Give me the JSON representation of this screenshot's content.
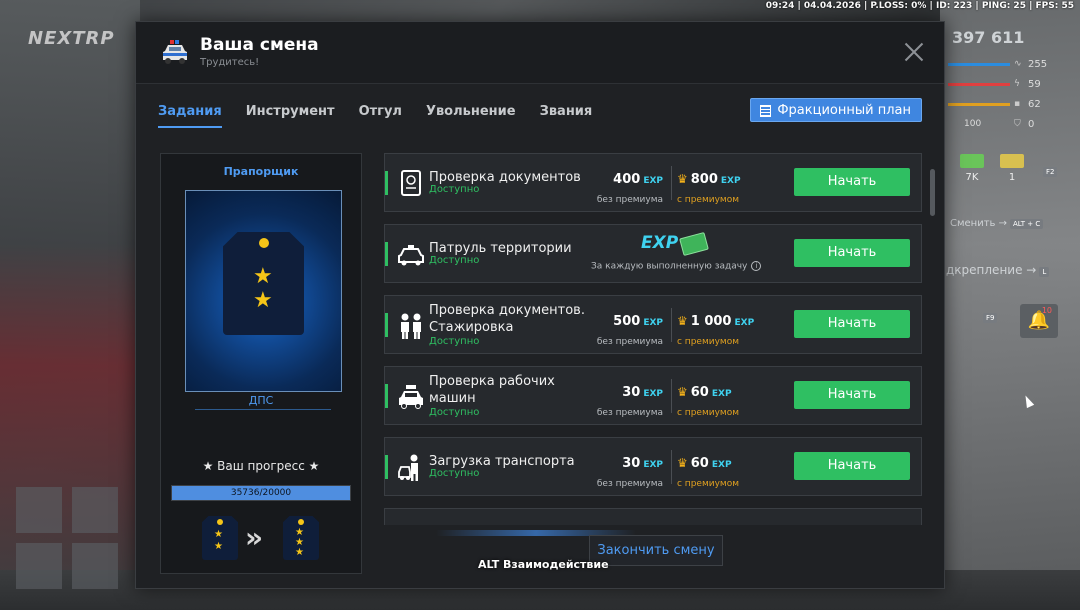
{
  "topbar": {
    "status": "09:24 | 04.04.2026 | P.LOSS: 0% | ID: 223 | PING: 25 | FPS: 55"
  },
  "hud": {
    "logo": "NEXTRP",
    "money": "397 611",
    "stats": [
      {
        "value": "255",
        "color": "#2b8de0"
      },
      {
        "value": "59",
        "color": "#e04040"
      },
      {
        "value": "62",
        "color": "#e0a020"
      },
      {
        "value": "0",
        "color": "#888888"
      }
    ],
    "stat_extra": "100",
    "cash": [
      {
        "label": "7K",
        "color": "#6ac45a"
      },
      {
        "label": "1",
        "color": "#d8c050"
      }
    ],
    "key_f2": "F2",
    "change_text": "Сменить →",
    "change_keys": "ALT + C",
    "reinforce_text": "дкрепление →",
    "reinforce_key": "L",
    "key_f9": "F9",
    "bell_count": "10"
  },
  "panel": {
    "title": "Ваша смена",
    "subtitle": "Трудитесь!",
    "tabs": [
      "Задания",
      "Инструмент",
      "Отгул",
      "Увольнение",
      "Звания"
    ],
    "plan_button": "Фракционный план",
    "rank": {
      "name": "Прапорщик",
      "department": "ДПС",
      "progress_label": "★ Ваш прогресс ★",
      "progress_text": "35736/20000",
      "progress_fraction": 1.0
    },
    "exp_label": "EXP",
    "no_premium": "без премиума",
    "with_premium": "с премиумом",
    "start_label": "Начать",
    "tasks": [
      {
        "name": "Проверка документов",
        "status": "Доступно",
        "base": "400",
        "premium": "800",
        "icon": "passport-icon"
      },
      {
        "name": "Патруль территории",
        "status": "Доступно",
        "caption": "За каждую выполненную задачу",
        "icon": "police-car-icon"
      },
      {
        "name": "Проверка документов. Стажировка",
        "status": "Доступно",
        "base": "500",
        "premium": "1 000",
        "icon": "officers-icon"
      },
      {
        "name": "Проверка рабочих машин",
        "status": "Доступно",
        "base": "30",
        "premium": "60",
        "icon": "work-car-icon"
      },
      {
        "name": "Загрузка транспорта",
        "status": "Доступно",
        "base": "30",
        "premium": "60",
        "icon": "loading-icon"
      }
    ],
    "finish_button": "Закончить смену",
    "alt_hint": "ALT Взаимодействие"
  }
}
